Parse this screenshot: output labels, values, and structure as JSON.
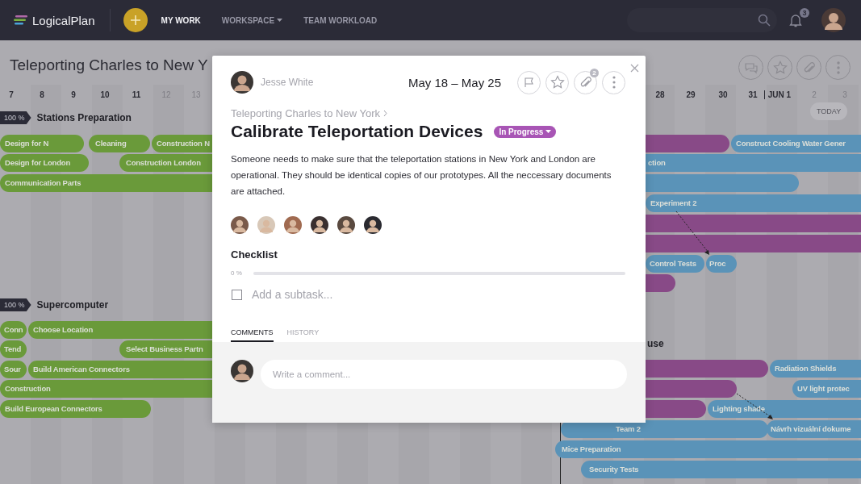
{
  "topbar": {
    "logo": "LogicalPlan",
    "nav": [
      {
        "label": "MY WORK",
        "selected": true,
        "dropdown": false
      },
      {
        "label": "WORKSPACE",
        "selected": false,
        "dropdown": true
      },
      {
        "label": "TEAM WORKLOAD",
        "selected": false,
        "dropdown": false
      }
    ],
    "notifications": "3"
  },
  "project": {
    "title": "Teleporting Charles to New Y"
  },
  "timeline": {
    "days": [
      {
        "label": "7",
        "weekend": false
      },
      {
        "label": "8",
        "weekend": false
      },
      {
        "label": "9",
        "weekend": false
      },
      {
        "label": "10",
        "weekend": false
      },
      {
        "label": "11",
        "weekend": false
      },
      {
        "label": "12",
        "weekend": true
      },
      {
        "label": "13",
        "weekend": true
      },
      {
        "label": "28",
        "weekend": false
      },
      {
        "label": "29",
        "weekend": false
      },
      {
        "label": "30",
        "weekend": false
      },
      {
        "label": "31",
        "weekend": false
      },
      {
        "label": "JUN 1",
        "weekend": false
      },
      {
        "label": "2",
        "weekend": true
      },
      {
        "label": "3",
        "weekend": true
      }
    ],
    "today": "TODAY",
    "sections": [
      {
        "progress": "100 %",
        "title": "Stations Preparation"
      },
      {
        "progress": "100 %",
        "title": "Supercomputer"
      },
      {
        "title": "use"
      }
    ],
    "bars": [
      {
        "label": "Design for N",
        "color": "#6a9a3a"
      },
      {
        "label": "Cleaning",
        "color": "#6a9a3a"
      },
      {
        "label": "Construction N",
        "color": "#6a9a3a"
      },
      {
        "label": "Design for London",
        "color": "#6a9a3a"
      },
      {
        "label": "Construction London",
        "color": "#6a9a3a"
      },
      {
        "label": "Communication Parts",
        "color": "#6a9a3a"
      },
      {
        "label": "Conn",
        "color": "#6a9a3a"
      },
      {
        "label": "Choose Location",
        "color": "#6a9a3a"
      },
      {
        "label": "Tend",
        "color": "#6a9a3a"
      },
      {
        "label": "Select Business Partn",
        "color": "#6a9a3a"
      },
      {
        "label": "Sour",
        "color": "#6a9a3a"
      },
      {
        "label": "Build American Connectors",
        "color": "#6a9a3a"
      },
      {
        "label": "Construction",
        "color": "#6a9a3a"
      },
      {
        "label": "Build European Connectors",
        "color": "#6a9a3a"
      },
      {
        "color": "#884a87"
      },
      {
        "label": "Construct Cooling Water Gener",
        "color": "#5a93b8"
      },
      {
        "label": "ction",
        "color": "#5a93b8"
      },
      {
        "color": "#5a93b8"
      },
      {
        "label": "Experiment 2",
        "color": "#5a93b8"
      },
      {
        "color": "#884a87"
      },
      {
        "color": "#884a87"
      },
      {
        "label": "Control Tests",
        "color": "#5a93b8"
      },
      {
        "label": "Proc",
        "color": "#5a93b8"
      },
      {
        "color": "#884a87"
      },
      {
        "color": "#884a87"
      },
      {
        "label": "Radiation Shields",
        "color": "#5a93b8"
      },
      {
        "color": "#884a87"
      },
      {
        "label": "UV light protec",
        "color": "#5a93b8"
      },
      {
        "color": "#884a87"
      },
      {
        "label": "Lighting shade",
        "color": "#5a93b8"
      },
      {
        "label": "Team 2",
        "color": "#5a93b8"
      },
      {
        "label": "Návrh vizuální dokume",
        "color": "#5a93b8"
      },
      {
        "label": "Mice Preparation",
        "color": "#5a93b8"
      },
      {
        "label": "Security Tests",
        "color": "#5a93b8"
      }
    ]
  },
  "modal": {
    "owner": "Jesse White",
    "dates": "May 18 – May 25",
    "attachments": "2",
    "breadcrumb": "Teleporting Charles to New York",
    "title": "Calibrate Teleportation Devices",
    "status": "In Progress",
    "description": "Someone needs to make sure that the teleportation stations in New York and London are operational. They should be identical copies of our prototypes. All the neccessary documents are attached.",
    "checklist": {
      "title": "Checklist",
      "percent": "0 %",
      "level": 0,
      "checked": false,
      "placeholder": "Add a subtask..."
    },
    "tabs": [
      {
        "label": "COMMENTS",
        "selected": true
      },
      {
        "label": "HISTORY",
        "selected": false
      }
    ],
    "comment_placeholder": "Write a comment..."
  }
}
